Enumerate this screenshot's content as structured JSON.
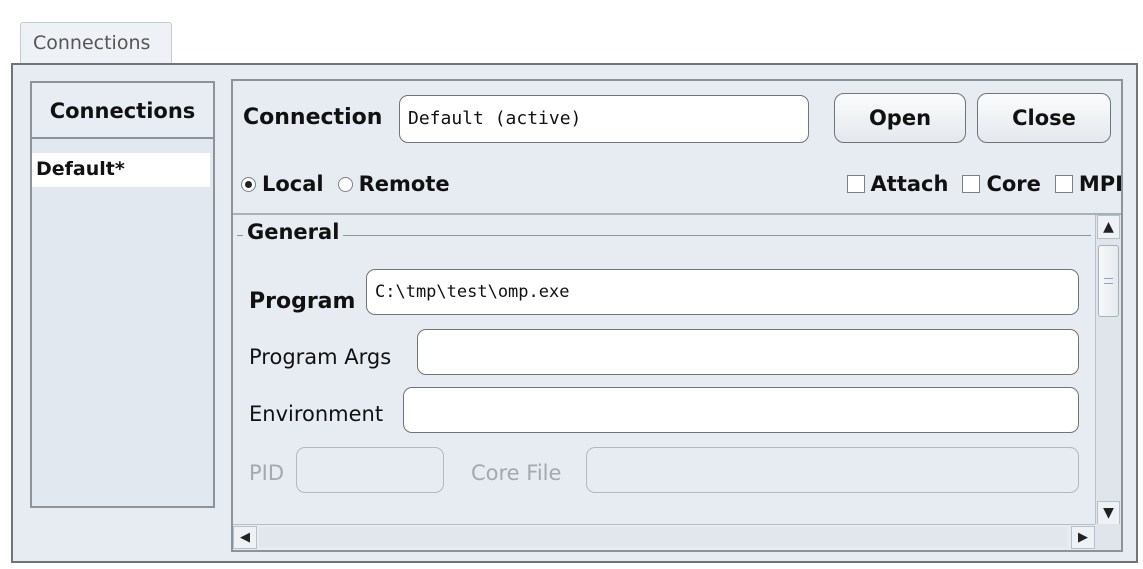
{
  "tab": {
    "label": "Connections"
  },
  "left": {
    "header": "Connections",
    "items": [
      {
        "label": "Default*"
      }
    ]
  },
  "connection": {
    "label": "Connection",
    "value": "Default (active)",
    "open_label": "Open",
    "close_label": "Close"
  },
  "mode": {
    "local_label": "Local",
    "remote_label": "Remote",
    "selected": "Local"
  },
  "options": {
    "attach_label": "Attach",
    "core_label": "Core",
    "mpi_label": "MPI"
  },
  "general": {
    "legend": "General",
    "program_label": "Program",
    "program_value": "C:\\tmp\\test\\omp.exe",
    "args_label": "Program Args",
    "args_value": "",
    "env_label": "Environment",
    "env_value": "",
    "pid_label": "PID",
    "pid_value": "",
    "corefile_label": "Core File",
    "corefile_value": ""
  }
}
